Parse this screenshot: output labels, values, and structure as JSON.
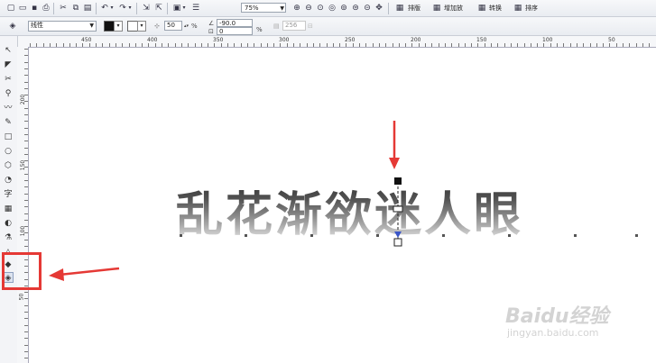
{
  "toolbar": {
    "zoom_level": "75%",
    "buttons": [
      "new-icon",
      "open-icon",
      "save-icon",
      "print-icon",
      "cut-icon",
      "copy-icon",
      "paste-icon",
      "undo-icon",
      "redo-icon",
      "import-icon",
      "export-icon",
      "app-launcher-icon",
      "options-icon"
    ],
    "zoom_buttons": [
      "zoom-in-icon",
      "zoom-out-icon",
      "zoom-selection-icon",
      "zoom-all-icon",
      "zoom-page-icon",
      "zoom-width-icon",
      "zoom-height-icon",
      "pan-icon"
    ],
    "layout_text": "排版",
    "stack_text": "增加放",
    "align_text": "转换",
    "order_text": "排序"
  },
  "property_bar": {
    "fill_type": "线性",
    "midpoint_value": "50",
    "midpoint_unit": "%",
    "angle_value": "-90.0",
    "edge_value": "0",
    "edge_unit": "%",
    "steps_value": "256"
  },
  "ruler": {
    "h_labels": [
      "450",
      "400",
      "350",
      "300",
      "250",
      "200",
      "150",
      "100",
      "50"
    ],
    "v_labels": [
      "200",
      "150",
      "100",
      "50"
    ]
  },
  "canvas": {
    "headline": "乱花渐欲迷人眼"
  },
  "watermark": {
    "brand": "Baidu经验",
    "url": "jingyan.baidu.com"
  },
  "colors": {
    "highlight": "#e53935",
    "arrow": "#e53935",
    "handle_blue": "#3a55c8"
  }
}
